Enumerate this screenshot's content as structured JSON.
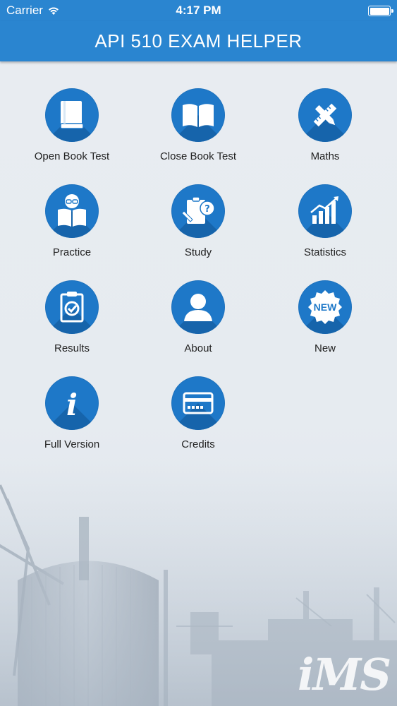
{
  "status_bar": {
    "carrier": "Carrier",
    "time": "4:17 PM"
  },
  "nav": {
    "title": "API 510 EXAM HELPER"
  },
  "tiles": [
    {
      "label": "Open Book Test",
      "icon": "closed-book-icon"
    },
    {
      "label": "Close Book Test",
      "icon": "open-book-icon"
    },
    {
      "label": "Maths",
      "icon": "pencil-ruler-icon"
    },
    {
      "label": "Practice",
      "icon": "reader-icon"
    },
    {
      "label": "Study",
      "icon": "clipboard-question-icon"
    },
    {
      "label": "Statistics",
      "icon": "chart-icon"
    },
    {
      "label": "Results",
      "icon": "checklist-icon"
    },
    {
      "label": "About",
      "icon": "person-icon"
    },
    {
      "label": "New",
      "icon": "new-badge-icon",
      "badge_text": "NEW"
    },
    {
      "label": "Full Version",
      "icon": "info-icon",
      "glyph": "i"
    },
    {
      "label": "Credits",
      "icon": "credit-card-icon"
    }
  ],
  "watermark": "iMS",
  "colors": {
    "primary": "#2a85d0",
    "icon_circle": "#1e78c8",
    "background": "#e9edf2"
  }
}
